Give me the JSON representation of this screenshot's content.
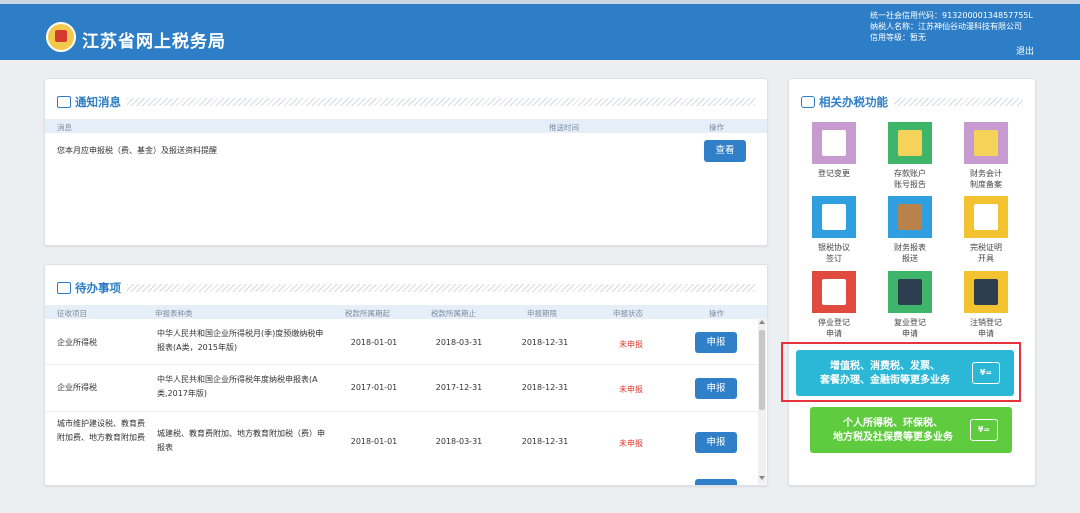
{
  "header": {
    "site_title": "江苏省网上税务局",
    "credit_code": "统一社会信用代码：9132000013485775​5L",
    "taxpayer_name": "纳税人名称：江苏神仙谷动漫科技有限公司",
    "credit_level": "信用等级：暂无",
    "logout": "退出"
  },
  "notice": {
    "title": "通知消息",
    "columns": [
      "消息",
      "推送时间",
      "操作"
    ],
    "rows": [
      {
        "message": "您本月应申报税（费、基金）及报送资料提醒",
        "time": "",
        "action": "查看"
      }
    ]
  },
  "todo": {
    "title": "待办事项",
    "columns": [
      "征收项目",
      "申报表种类",
      "税款所属期起",
      "税款所属期止",
      "申报期限",
      "申报状态",
      "操作"
    ],
    "rows": [
      {
        "item": "企业所得税",
        "form": "中华人民共和国企业所得税月(季)度预缴纳税申报表(A类，2015年版)",
        "start": "2018-01-01",
        "end": "2018-03-31",
        "deadline": "2018-12-31",
        "status": "未申报",
        "action": "申报"
      },
      {
        "item": "企业所得税",
        "form": "中华人民共和国企业所得税年度纳税申报表(A类,2017年版)",
        "start": "2017-01-01",
        "end": "2017-12-31",
        "deadline": "2018-12-31",
        "status": "未申报",
        "action": "申报"
      },
      {
        "item": "城市维护建设税、教育费附加费、地方教育附加费",
        "form": "城建税、教育费附加、地方教育附加税（费）申报表",
        "start": "2018-01-01",
        "end": "2018-03-31",
        "deadline": "2018-12-31",
        "status": "未申报",
        "action": "申报"
      }
    ]
  },
  "functions": {
    "title": "相关办税功能",
    "items": [
      {
        "label1": "登记变更",
        "label2": "",
        "icon": "registration-change-icon",
        "bg": "#c79bd0",
        "fg": "#ffffff"
      },
      {
        "label1": "存款账户",
        "label2": "账号报告",
        "icon": "bank-card-icon",
        "bg": "#3fb56a",
        "fg": "#f5d35a"
      },
      {
        "label1": "财务会计",
        "label2": "制度备案",
        "icon": "ledger-icon",
        "bg": "#c79bd0",
        "fg": "#f5d35a"
      },
      {
        "label1": "银税协议",
        "label2": "签订",
        "icon": "agreement-icon",
        "bg": "#2f9fe0",
        "fg": "#ffffff"
      },
      {
        "label1": "财务报表",
        "label2": "报送",
        "icon": "briefcase-icon",
        "bg": "#2f9fe0",
        "fg": "#b9824a"
      },
      {
        "label1": "完税证明",
        "label2": "开具",
        "icon": "certificate-icon",
        "bg": "#f2c230",
        "fg": "#ffffff"
      },
      {
        "label1": "停业登记",
        "label2": "申请",
        "icon": "suspend-doc-icon",
        "bg": "#e14a3e",
        "fg": "#ffffff"
      },
      {
        "label1": "复业登记",
        "label2": "申请",
        "icon": "printer-icon",
        "bg": "#3fb56a",
        "fg": "#2c3e50"
      },
      {
        "label1": "注销登记",
        "label2": "申请",
        "icon": "cancel-register-icon",
        "bg": "#f2c230",
        "fg": "#2c3e50"
      }
    ],
    "vat_button": {
      "line1": "增值税、消费税、发票、",
      "line2": "套餐办理、金融街等更多业务",
      "icon_text": "¥=",
      "color": "#2bb8d6"
    },
    "personal_button": {
      "line1": "个人所得税、环保税、",
      "line2": "地方税及社保费等更多业务",
      "icon_text": "¥=",
      "color": "#5fcb3e"
    }
  }
}
